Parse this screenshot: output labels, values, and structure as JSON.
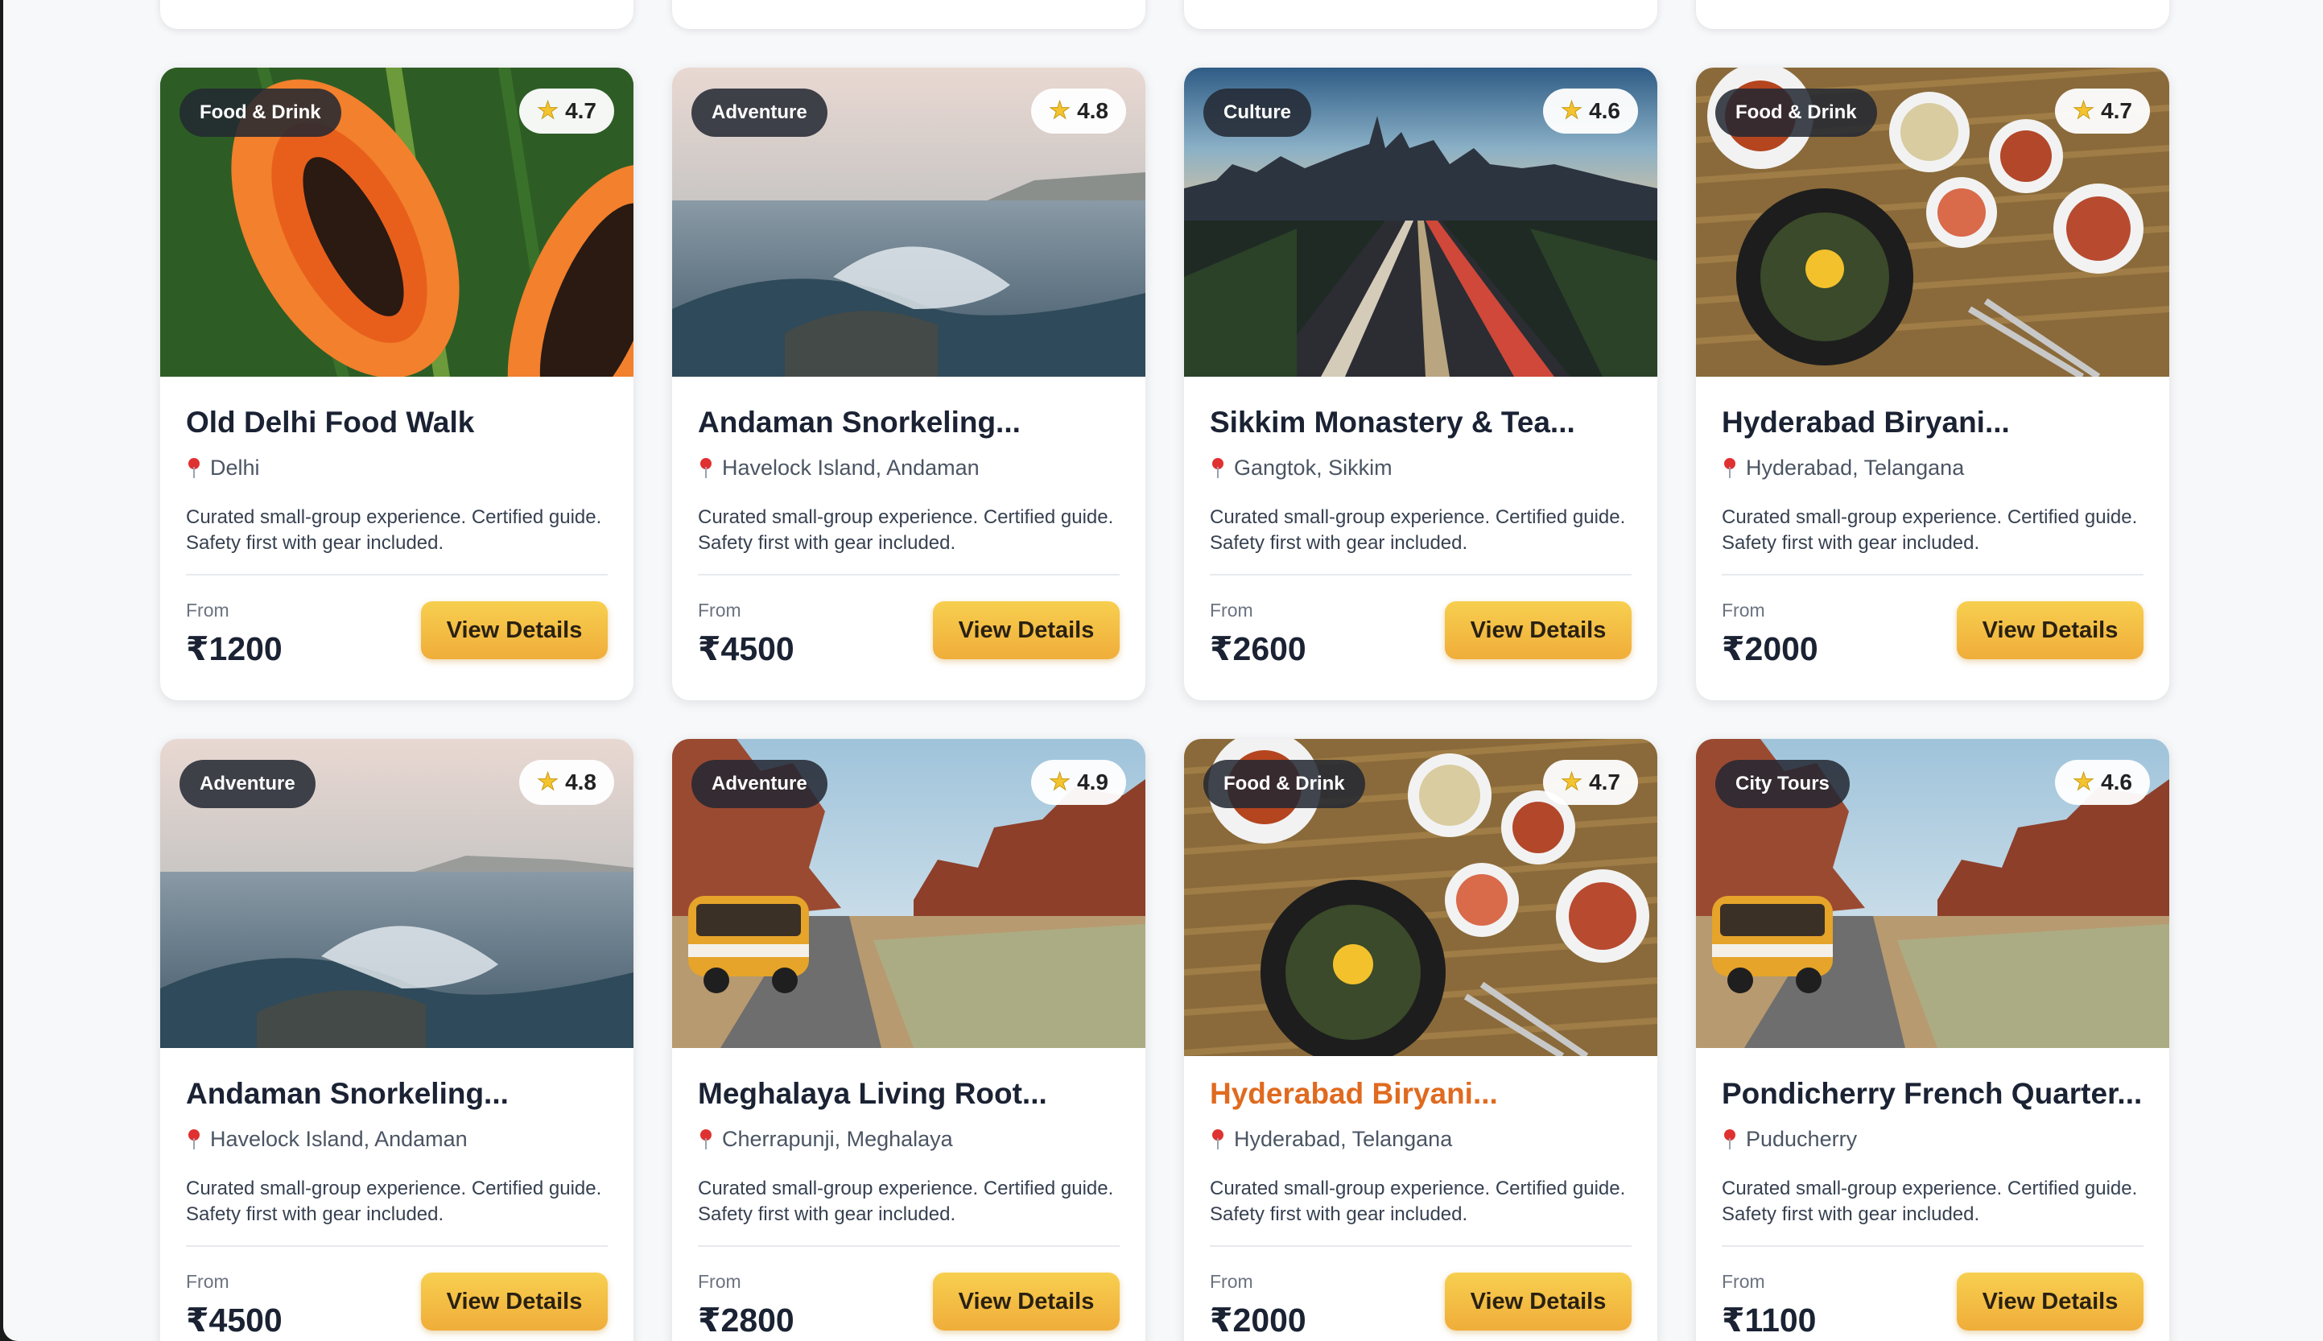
{
  "cards": [
    {
      "category": "Food & Drink",
      "rating": "4.7",
      "title": "Old Delhi Food Walk",
      "location": "Delhi",
      "description": "Curated small-group experience. Certified guide. Safety first with gear included.",
      "from_label": "From",
      "price": "₹1200",
      "button": "View Details",
      "image": "papaya-image"
    },
    {
      "category": "Adventure",
      "rating": "4.8",
      "title": "Andaman Snorkeling...",
      "location": "Havelock Island, Andaman",
      "description": "Curated small-group experience. Certified guide. Safety first with gear included.",
      "from_label": "From",
      "price": "₹4500",
      "button": "View Details",
      "image": "ocean-wave-image"
    },
    {
      "category": "Culture",
      "rating": "4.6",
      "title": "Sikkim Monastery & Tea...",
      "location": "Gangtok, Sikkim",
      "description": "Curated small-group experience. Certified guide. Safety first with gear included.",
      "from_label": "From",
      "price": "₹2600",
      "button": "View Details",
      "image": "city-highway-image"
    },
    {
      "category": "Food & Drink",
      "rating": "4.7",
      "title": "Hyderabad Biryani...",
      "location": "Hyderabad, Telangana",
      "description": "Curated small-group experience. Certified guide. Safety first with gear included.",
      "from_label": "From",
      "price": "₹2000",
      "button": "View Details",
      "image": "food-table-image"
    },
    {
      "category": "Adventure",
      "rating": "4.8",
      "title": "Andaman Snorkeling...",
      "location": "Havelock Island, Andaman",
      "description": "Curated small-group experience. Certified guide. Safety first with gear included.",
      "from_label": "From",
      "price": "₹4500",
      "button": "View Details",
      "image": "ocean-wave-image"
    },
    {
      "category": "Adventure",
      "rating": "4.9",
      "title": "Meghalaya Living Root...",
      "location": "Cherrapunji, Meghalaya",
      "description": "Curated small-group experience. Certified guide. Safety first with gear included.",
      "from_label": "From",
      "price": "₹2800",
      "button": "View Details",
      "image": "desert-van-image"
    },
    {
      "category": "Food & Drink",
      "rating": "4.7",
      "title": "Hyderabad Biryani...",
      "location": "Hyderabad, Telangana",
      "description": "Curated small-group experience. Certified guide. Safety first with gear included.",
      "from_label": "From",
      "price": "₹2000",
      "button": "View Details",
      "image": "food-table-image",
      "hovered": true
    },
    {
      "category": "City Tours",
      "rating": "4.6",
      "title": "Pondicherry French Quarter...",
      "location": "Puducherry",
      "description": "Curated small-group experience. Certified guide. Safety first with gear included.",
      "from_label": "From",
      "price": "₹1100",
      "button": "View Details",
      "image": "desert-van-image"
    }
  ],
  "colors": {
    "accent_button": "#f2bd45",
    "hover_title": "#e06a1f",
    "pin": "#e03131"
  }
}
